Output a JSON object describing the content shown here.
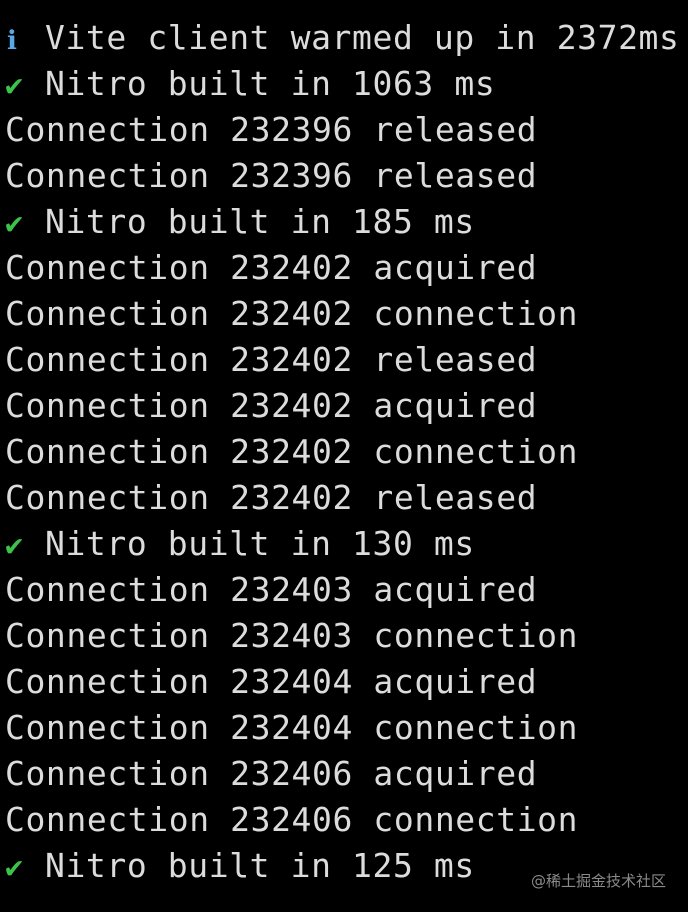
{
  "colors": {
    "background": "#000000",
    "text": "#dcdcdc",
    "info": "#5aa9e6",
    "success": "#3cc44a"
  },
  "terminal": {
    "lines": [
      {
        "icon": "info-icon",
        "glyph": "ℹ",
        "text": "Vite client warmed up in 2372ms"
      },
      {
        "icon": "check-icon",
        "glyph": "✔",
        "text": "Nitro built in 1063 ms"
      },
      {
        "icon": "",
        "glyph": "",
        "text": "Connection 232396 released"
      },
      {
        "icon": "",
        "glyph": "",
        "text": "Connection 232396 released"
      },
      {
        "icon": "check-icon",
        "glyph": "✔",
        "text": "Nitro built in 185 ms"
      },
      {
        "icon": "",
        "glyph": "",
        "text": "Connection 232402 acquired"
      },
      {
        "icon": "",
        "glyph": "",
        "text": "Connection 232402 connection"
      },
      {
        "icon": "",
        "glyph": "",
        "text": "Connection 232402 released"
      },
      {
        "icon": "",
        "glyph": "",
        "text": "Connection 232402 acquired"
      },
      {
        "icon": "",
        "glyph": "",
        "text": "Connection 232402 connection"
      },
      {
        "icon": "",
        "glyph": "",
        "text": "Connection 232402 released"
      },
      {
        "icon": "check-icon",
        "glyph": "✔",
        "text": "Nitro built in 130 ms"
      },
      {
        "icon": "",
        "glyph": "",
        "text": "Connection 232403 acquired"
      },
      {
        "icon": "",
        "glyph": "",
        "text": "Connection 232403 connection"
      },
      {
        "icon": "",
        "glyph": "",
        "text": "Connection 232404 acquired"
      },
      {
        "icon": "",
        "glyph": "",
        "text": "Connection 232404 connection"
      },
      {
        "icon": "",
        "glyph": "",
        "text": "Connection 232406 acquired"
      },
      {
        "icon": "",
        "glyph": "",
        "text": "Connection 232406 connection"
      },
      {
        "icon": "check-icon",
        "glyph": "✔",
        "text": "Nitro built in 125 ms"
      }
    ]
  },
  "watermark": "@稀土掘金技术社区"
}
